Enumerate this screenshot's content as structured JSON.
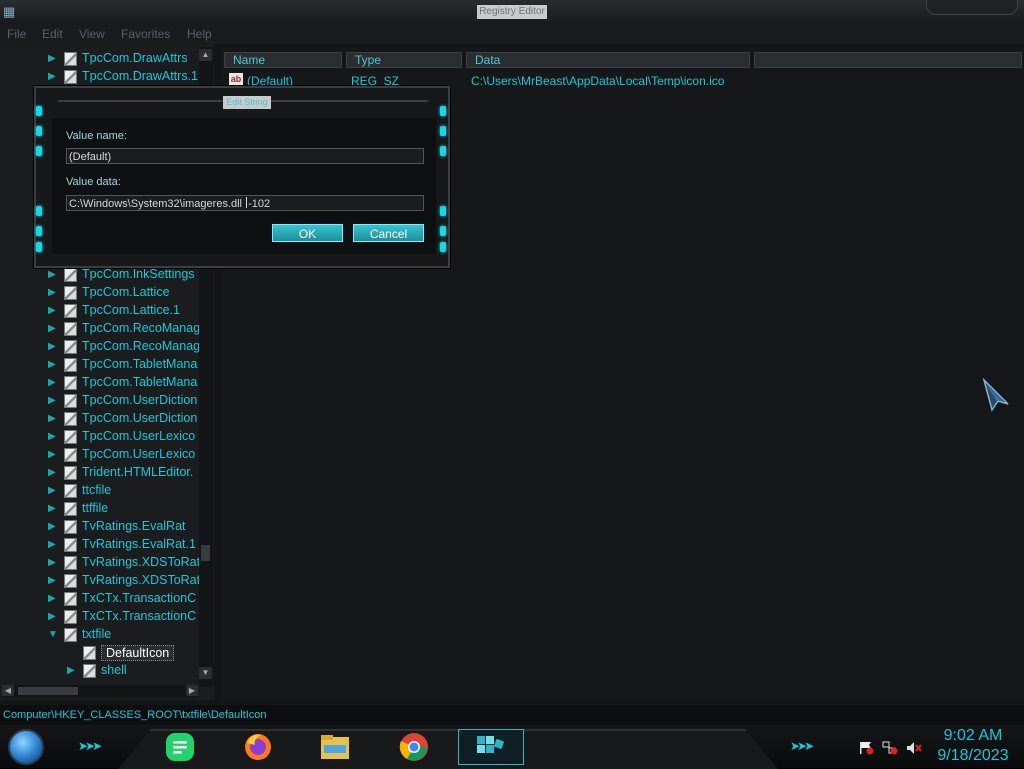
{
  "window": {
    "title": "Registry Editor",
    "menu": [
      "File",
      "Edit",
      "View",
      "Favorites",
      "Help"
    ]
  },
  "tree": {
    "items": [
      {
        "label": "TpcCom.DrawAttrs",
        "expanded": false
      },
      {
        "label": "TpcCom.DrawAttrs.1",
        "expanded": false
      },
      {
        "label": "TpcCom.InkSettings",
        "expanded": false
      },
      {
        "label": "TpcCom.Lattice",
        "expanded": false
      },
      {
        "label": "TpcCom.Lattice.1",
        "expanded": false
      },
      {
        "label": "TpcCom.RecoManag",
        "expanded": false
      },
      {
        "label": "TpcCom.RecoManag",
        "expanded": false
      },
      {
        "label": "TpcCom.TabletMana",
        "expanded": false
      },
      {
        "label": "TpcCom.TabletMana",
        "expanded": false
      },
      {
        "label": "TpcCom.UserDiction",
        "expanded": false
      },
      {
        "label": "TpcCom.UserDiction",
        "expanded": false
      },
      {
        "label": "TpcCom.UserLexico",
        "expanded": false
      },
      {
        "label": "TpcCom.UserLexico",
        "expanded": false
      },
      {
        "label": "Trident.HTMLEditor.",
        "expanded": false
      },
      {
        "label": "ttcfile",
        "expanded": false
      },
      {
        "label": "ttffile",
        "expanded": false
      },
      {
        "label": "TvRatings.EvalRat",
        "expanded": false
      },
      {
        "label": "TvRatings.EvalRat.1",
        "expanded": false
      },
      {
        "label": "TvRatings.XDSToRat",
        "expanded": false
      },
      {
        "label": "TvRatings.XDSToRat",
        "expanded": false
      },
      {
        "label": "TxCTx.TransactionC",
        "expanded": false
      },
      {
        "label": "TxCTx.TransactionC",
        "expanded": false
      },
      {
        "label": "txtfile",
        "expanded": true
      },
      {
        "label": "DefaultIcon",
        "selected": true
      },
      {
        "label": "shell",
        "expanded": false
      }
    ]
  },
  "list": {
    "columns": [
      "Name",
      "Type",
      "Data"
    ],
    "rows": [
      {
        "name": "(Default)",
        "type": "REG_SZ",
        "data": "C:\\Users\\MrBeast\\AppData\\Local\\Temp\\icon.ico"
      }
    ]
  },
  "dialog": {
    "title": "Edit String",
    "value_name_label": "Value name:",
    "value_name": "(Default)",
    "value_data_label": "Value data:",
    "value_data_before_caret": "C:\\Windows\\System32\\imageres.dll ",
    "value_data_after_caret": "-102",
    "ok_label": "OK",
    "cancel_label": "Cancel"
  },
  "status_bar": {
    "path": "Computer\\HKEY_CLASSES_ROOT\\txtfile\\DefaultIcon"
  },
  "taskbar": {
    "apps": [
      {
        "name": "notes-app-icon"
      },
      {
        "name": "firefox-icon"
      },
      {
        "name": "file-explorer-icon"
      },
      {
        "name": "chrome-icon"
      },
      {
        "name": "registry-editor-icon"
      }
    ],
    "clock": {
      "time": "9:02 AM",
      "date": "9/18/2023"
    }
  },
  "colors": {
    "accent": "#18c9d9",
    "background": "#141516"
  }
}
